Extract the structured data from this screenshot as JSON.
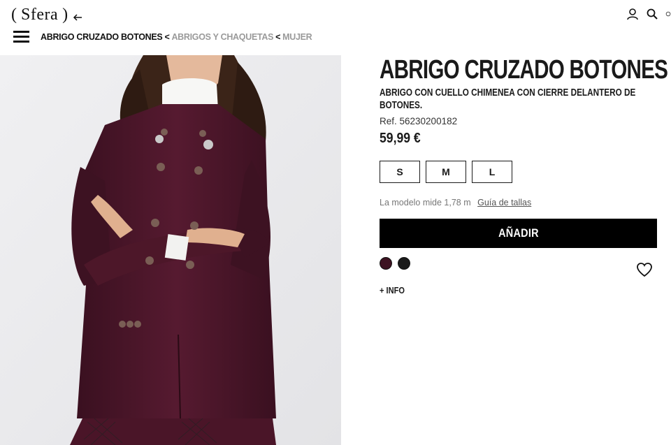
{
  "header": {
    "logo": "Sfera",
    "icons": [
      "back-arrow-icon",
      "user-icon",
      "search-icon",
      "bag-icon"
    ]
  },
  "breadcrumb": {
    "current": "ABRIGO CRUZADO BOTONES",
    "separator": "<",
    "items": [
      "ABRIGOS Y CHAQUETAS",
      "MUJER"
    ]
  },
  "product": {
    "title": "ABRIGO CRUZADO BOTONES",
    "subtitle": "ABRIGO CON CUELLO CHIMENEA CON CIERRE DELANTERO DE BOTONES.",
    "ref": "Ref. 56230200182",
    "price": "59,99 €",
    "sizes": [
      "S",
      "M",
      "L"
    ],
    "model_text": "La modelo mide 1,78 m",
    "size_guide": "Guía de tallas",
    "add_button": "AÑADIR",
    "more_info": "+ INFO",
    "colors": {
      "burgundy": "#3d1322",
      "black": "#1a1a1a"
    }
  }
}
